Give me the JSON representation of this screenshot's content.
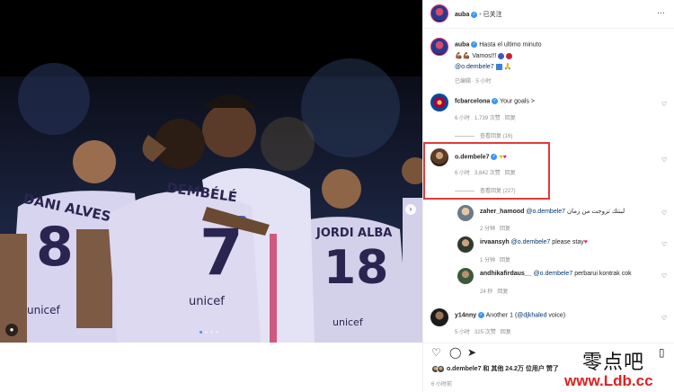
{
  "post": {
    "header": {
      "username": "auba",
      "separator": "•",
      "follow_status": "已关注",
      "more": "···"
    },
    "caption": {
      "username": "auba",
      "text": "Hasta el ultimo minuto",
      "line2_text": "Vamos!!!",
      "mention": "@o.dembele7",
      "time": "已编辑 · 5 小时"
    },
    "jerseys": {
      "left": "DANI ALVES",
      "left_number": "8",
      "center": "DEMBÉLÉ",
      "center_number": "7",
      "right": "JORDI ALBA",
      "right_number": "18",
      "sponsor": "unicef"
    }
  },
  "comments": [
    {
      "username": "fcbarcelona",
      "text": "Your goals >",
      "time": "6 小时",
      "likes": "1,739 次赞",
      "reply": "回复",
      "view_replies": "查看回复 (16)"
    },
    {
      "username": "o.dembele7",
      "time": "6 小时",
      "likes": "3,842 次赞",
      "reply": "回复",
      "view_replies": "查看回复 (227)"
    },
    {
      "username": "zaher_hamood",
      "mention": "@o.dembele7",
      "text": "لبنتك تزوجت من زمان",
      "time": "2 分钟",
      "reply": "回复"
    },
    {
      "username": "irvaansyh",
      "mention": "@o.dembele7",
      "text": "please stay",
      "time": "1 分钟",
      "reply": "回复"
    },
    {
      "username": "andhikafirdaus__",
      "mention": "@o.dembele7",
      "text": "perbarui kontrak cok",
      "time": "24 秒",
      "reply": "回复"
    },
    {
      "username": "y14nny",
      "text_before": "Another 1 (",
      "mention": "@djkhaled",
      "text_after": " voice)",
      "time": "5 小时",
      "likes": "325 次赞",
      "reply": "回复"
    }
  ],
  "likes": {
    "text": "o.dembele7 和 其他 24.2万 位用户 赞了",
    "time": "6 小时前"
  },
  "watermark": {
    "top": "零点吧",
    "bottom": "www.Ldb.cc"
  },
  "colors": {
    "accent_blue": "#3897f0",
    "highlight_red": "#e03a3a",
    "barca_lilac": "#c9c6e8",
    "heart_red": "#e0245e"
  },
  "icons": [
    "heart-icon",
    "comment-icon",
    "share-icon",
    "bookmark-icon",
    "more-icon",
    "verified-icon",
    "tag-icon",
    "chevron-right-icon"
  ]
}
